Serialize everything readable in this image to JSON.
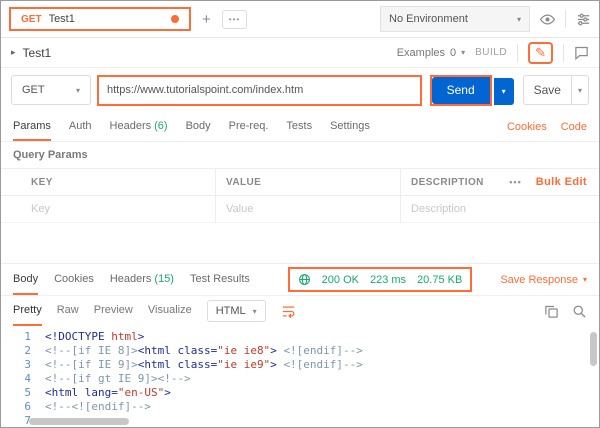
{
  "colors": {
    "accent": "#FF6C37",
    "send": "#0265D2",
    "green": "#1AAB6B"
  },
  "icons": {
    "caret_down": "▾",
    "arrow_right": "▸",
    "more_dots": "•••",
    "plus": "+",
    "pencil": "✎"
  },
  "topbar": {
    "tab": {
      "method": "GET",
      "name": "Test1"
    },
    "environment": "No Environment"
  },
  "request_header": {
    "title": "Test1",
    "examples_label": "Examples",
    "examples_count": "0",
    "build_label": "BUILD"
  },
  "request_bar": {
    "method": "GET",
    "url": "https://www.tutorialspoint.com/index.htm",
    "send_label": "Send",
    "save_label": "Save"
  },
  "request_tabs": [
    {
      "label": "Params"
    },
    {
      "label": "Auth"
    },
    {
      "label": "Headers",
      "count": "(6)"
    },
    {
      "label": "Body"
    },
    {
      "label": "Pre-req."
    },
    {
      "label": "Tests"
    },
    {
      "label": "Settings"
    }
  ],
  "request_links": {
    "cookies": "Cookies",
    "code": "Code"
  },
  "query_params": {
    "title": "Query Params",
    "columns": {
      "key": "KEY",
      "value": "VALUE",
      "description": "DESCRIPTION"
    },
    "bulk_edit": "Bulk Edit",
    "row": {
      "key_placeholder": "Key",
      "value_placeholder": "Value",
      "description_placeholder": "Description"
    }
  },
  "response": {
    "tabs": [
      {
        "label": "Body"
      },
      {
        "label": "Cookies"
      },
      {
        "label": "Headers",
        "count": "(15)"
      },
      {
        "label": "Test Results"
      }
    ],
    "status": {
      "code": "200 OK",
      "time": "223 ms",
      "size": "20.75 KB"
    },
    "save_response": "Save Response",
    "view_tabs": [
      {
        "label": "Pretty"
      },
      {
        "label": "Raw"
      },
      {
        "label": "Preview"
      },
      {
        "label": "Visualize"
      }
    ],
    "format": "HTML",
    "code_lines": [
      {
        "num": "1",
        "tokens": [
          {
            "t": "tag",
            "v": "<!DOCTYPE "
          },
          {
            "t": "red",
            "v": "html"
          },
          {
            "t": "tag",
            "v": ">"
          }
        ]
      },
      {
        "num": "2",
        "tokens": [
          {
            "t": "comment",
            "v": "<!--[if IE 8]>"
          },
          {
            "t": "tag",
            "v": "<html class="
          },
          {
            "t": "red",
            "v": "\"ie ie8\""
          },
          {
            "t": "tag",
            "v": "> "
          },
          {
            "t": "comment",
            "v": "<![endif]-->"
          }
        ]
      },
      {
        "num": "3",
        "tokens": [
          {
            "t": "comment",
            "v": "<!--[if IE 9]>"
          },
          {
            "t": "tag",
            "v": "<html class="
          },
          {
            "t": "red",
            "v": "\"ie ie9\""
          },
          {
            "t": "tag",
            "v": "> "
          },
          {
            "t": "comment",
            "v": "<![endif]-->"
          }
        ]
      },
      {
        "num": "4",
        "tokens": [
          {
            "t": "comment",
            "v": "<!--[if gt IE 9]><!-->"
          }
        ]
      },
      {
        "num": "5",
        "tokens": [
          {
            "t": "tag",
            "v": "<html lang="
          },
          {
            "t": "red",
            "v": "\"en-US\""
          },
          {
            "t": "tag",
            "v": ">"
          }
        ]
      },
      {
        "num": "6",
        "tokens": [
          {
            "t": "comment",
            "v": "<!--<![endif]-->"
          }
        ]
      },
      {
        "num": "7",
        "tokens": []
      }
    ]
  }
}
